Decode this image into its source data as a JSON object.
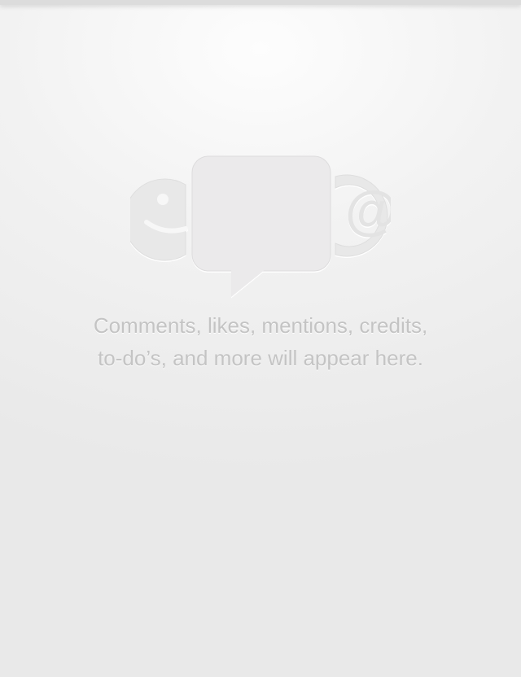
{
  "empty_state": {
    "icons": [
      "smiley-face-icon",
      "speech-bubble-icon",
      "at-sign-icon"
    ],
    "message_line_1": "Comments, likes, mentions, credits,",
    "message_line_2": "to-do’s, and more will appear here."
  },
  "colors": {
    "background_top": "#fdfdfd",
    "background_bottom": "#e9e9e9",
    "icon_fill": "#e9e9e9",
    "text": "#c4c4c4"
  }
}
